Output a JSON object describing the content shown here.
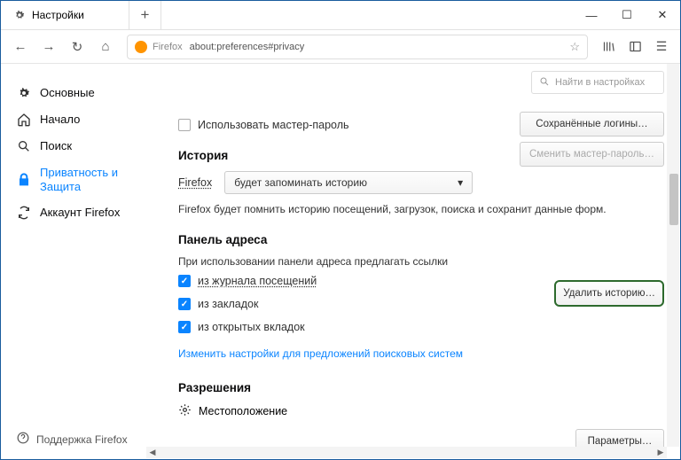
{
  "titlebar": {
    "tab_title": "Настройки"
  },
  "urlbar": {
    "brand": "Firefox",
    "url": "about:preferences#privacy"
  },
  "search": {
    "placeholder": "Найти в настройках"
  },
  "sidebar": {
    "items": [
      {
        "label": "Основные"
      },
      {
        "label": "Начало"
      },
      {
        "label": "Поиск"
      },
      {
        "label": "Приватность и Защита"
      },
      {
        "label": "Аккаунт Firefox"
      }
    ],
    "support": "Поддержка Firefox"
  },
  "buttons": {
    "saved_logins": "Сохранённые логины…",
    "change_master": "Сменить мастер-пароль…",
    "delete_history": "Удалить историю…",
    "params": "Параметры…"
  },
  "master_password": {
    "label": "Использовать мастер-пароль"
  },
  "history": {
    "heading": "История",
    "firefox_label": "Firefox",
    "select_value": "будет запоминать историю",
    "desc": "Firefox будет помнить историю посещений, загрузок, поиска и сохранит данные форм."
  },
  "addressbar": {
    "heading": "Панель адреса",
    "subtitle": "При использовании панели адреса предлагать ссылки",
    "options": [
      "из журнала посещений",
      "из закладок",
      "из открытых вкладок"
    ],
    "link": "Изменить настройки для предложений поисковых систем"
  },
  "permissions": {
    "heading": "Разрешения",
    "location": "Местоположение"
  }
}
